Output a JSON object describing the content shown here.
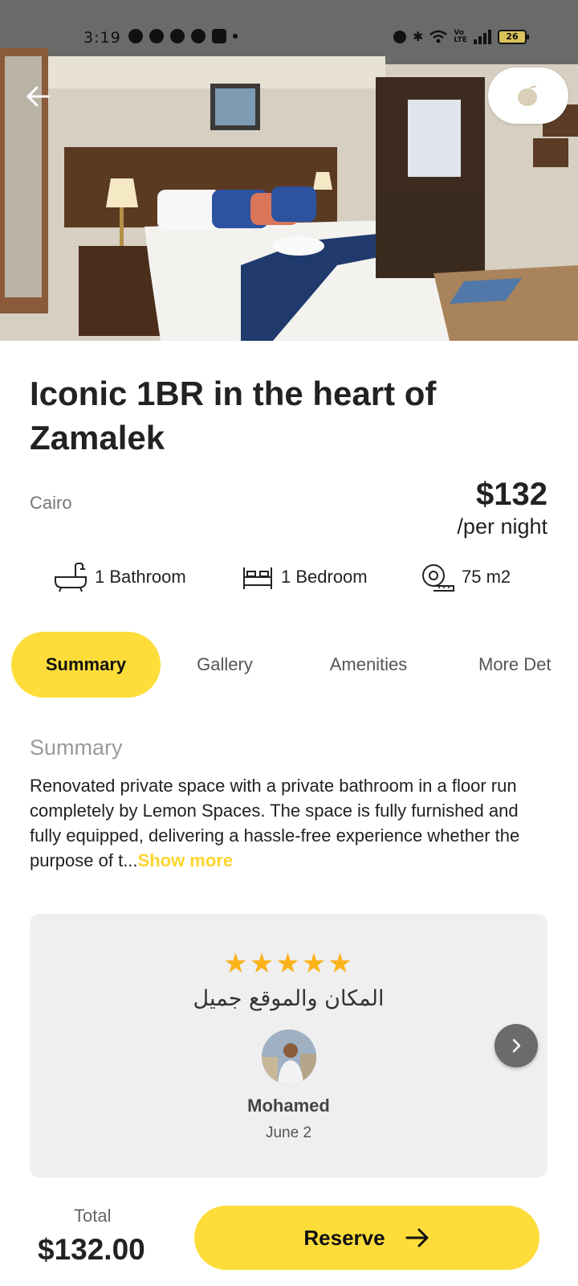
{
  "status_bar": {
    "time": "3:19",
    "battery": "26"
  },
  "listing": {
    "title": "Iconic 1BR in the heart of Zamalek",
    "city": "Cairo",
    "price": "$132",
    "price_unit": "/per night",
    "features": [
      {
        "icon": "bathtub-icon",
        "label": "1 Bathroom"
      },
      {
        "icon": "bed-icon",
        "label": "1 Bedroom"
      },
      {
        "icon": "tape-measure-icon",
        "label": "75 m2"
      }
    ]
  },
  "tabs": [
    {
      "label": "Summary",
      "active": true
    },
    {
      "label": "Gallery",
      "active": false
    },
    {
      "label": "Amenities",
      "active": false
    },
    {
      "label": "More Det",
      "active": false
    }
  ],
  "summary": {
    "heading": "Summary",
    "text": "Renovated private space with a private bathroom in a floor run completely by Lemon Spaces. The space is fully furnished and fully equipped, delivering a hassle-free experience whether the purpose of t...",
    "show_more": "Show more"
  },
  "review": {
    "rating": 5,
    "stars": "★★★★★",
    "text": "المكان والموقع جميل",
    "reviewer": "Mohamed",
    "date": "June 2"
  },
  "footer": {
    "total_label": "Total",
    "total_value": "$132.00",
    "reserve_label": "Reserve"
  },
  "colors": {
    "accent": "#fedd3b",
    "star": "#fcb21a",
    "show_more": "#fdd52c",
    "card_bg": "#efefef"
  }
}
